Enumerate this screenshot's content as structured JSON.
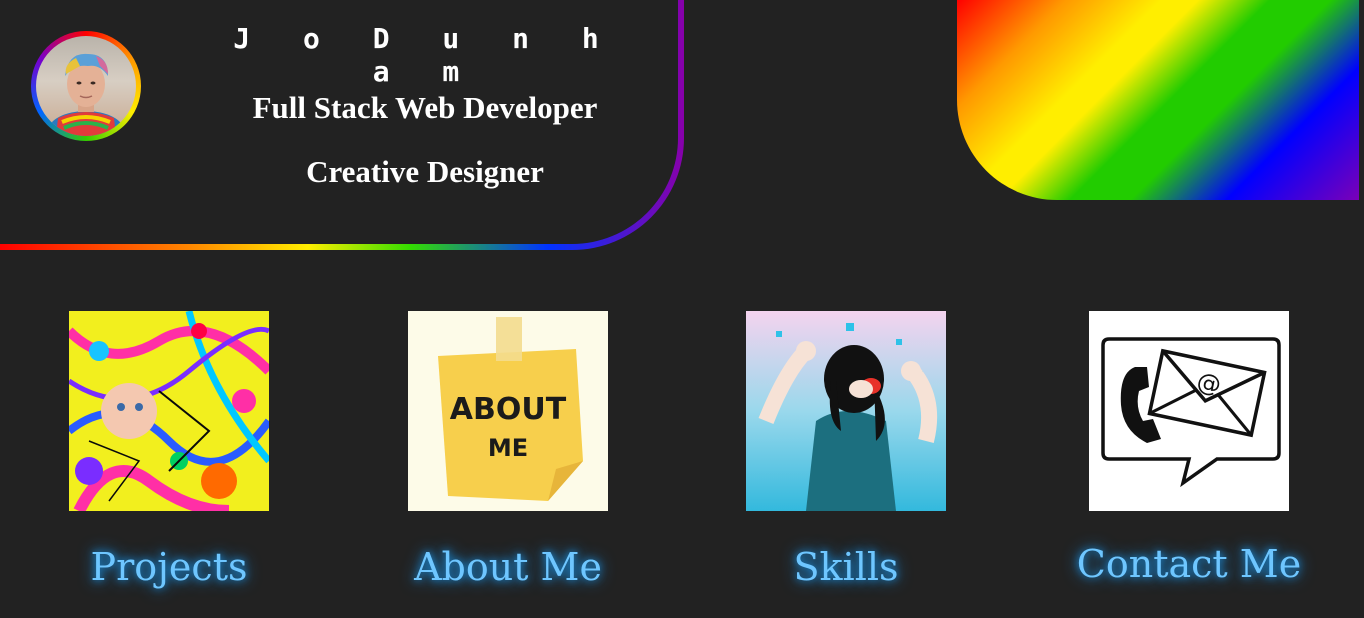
{
  "profile": {
    "name": "J o  D u n h a m",
    "role1": "Full Stack Web Developer",
    "role2": "Creative Designer",
    "avatar_icon": "profile-photo"
  },
  "nav": [
    {
      "label": "Projects",
      "icon": "paint-splatter-image"
    },
    {
      "label": "About Me",
      "icon": "sticky-note-image"
    },
    {
      "label": "Skills",
      "icon": "strong-woman-image"
    },
    {
      "label": "Contact Me",
      "icon": "phone-email-image"
    }
  ],
  "sticky_note": {
    "line1": "ABOUT",
    "line2": "ME"
  },
  "colors": {
    "background": "#222222",
    "label": "#6ec6ff",
    "glow": "#1a8fe0"
  }
}
